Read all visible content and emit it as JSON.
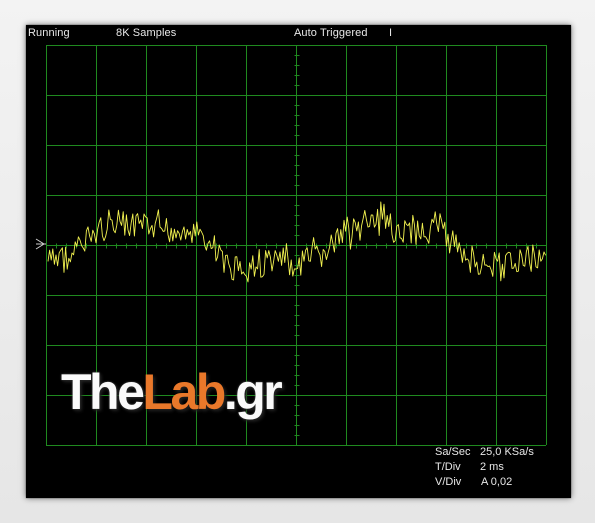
{
  "status_bar": {
    "run_state": "Running",
    "sample_count": "8K Samples",
    "trigger_mode": "Auto Triggered",
    "trigger_marker": "I"
  },
  "readouts": {
    "sample_rate_label": "Sa/Sec",
    "sample_rate_value": "25,0 KSa/s",
    "time_div_label": "T/Div",
    "time_div_value": "2 ms",
    "volt_div_label": "V/Div",
    "volt_div_value": "A 0,02"
  },
  "watermark": {
    "part1": "The",
    "part2": "Lab",
    "part3": ".gr"
  },
  "colors": {
    "grid": "#1f8a1f",
    "trace": "#f2f250",
    "background": "#000000",
    "text": "#e8e8e8"
  }
}
